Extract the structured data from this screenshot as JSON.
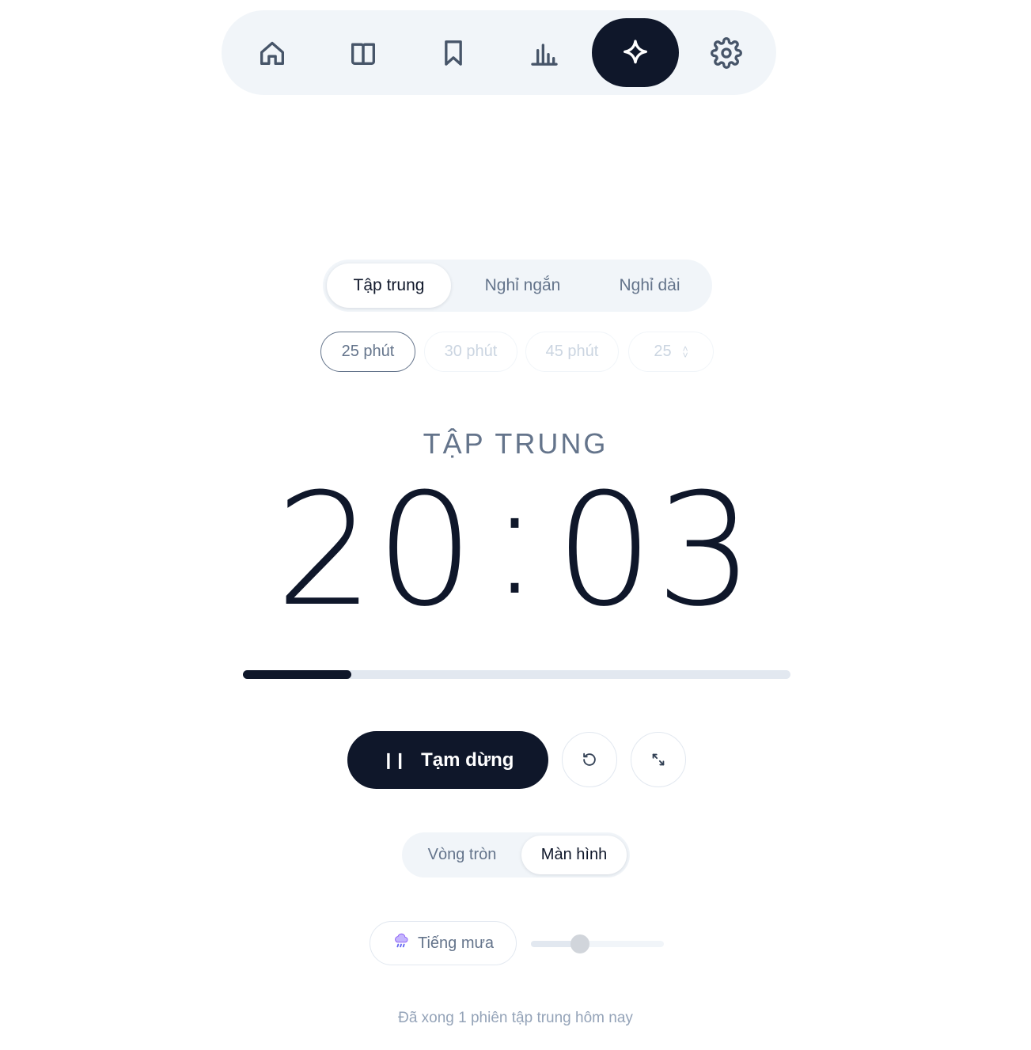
{
  "nav": {
    "items": [
      {
        "name": "home",
        "icon": "home-icon",
        "active": false
      },
      {
        "name": "library",
        "icon": "book-open-icon",
        "active": false
      },
      {
        "name": "bookmarks",
        "icon": "bookmark-icon",
        "active": false
      },
      {
        "name": "stats",
        "icon": "bar-chart-icon",
        "active": false
      },
      {
        "name": "focus",
        "icon": "sparkle-icon",
        "active": true
      },
      {
        "name": "settings",
        "icon": "gear-icon",
        "active": false
      }
    ]
  },
  "modes": {
    "tabs": [
      {
        "label": "Tập trung",
        "active": true
      },
      {
        "label": "Nghỉ ngắn",
        "active": false
      },
      {
        "label": "Nghỉ dài",
        "active": false
      }
    ]
  },
  "presets": {
    "options": [
      {
        "label": "25 phút",
        "active": true
      },
      {
        "label": "30 phút",
        "active": false
      },
      {
        "label": "45 phút",
        "active": false
      }
    ],
    "custom_value": "25"
  },
  "timer": {
    "label": "TẬP TRUNG",
    "minutes": "20",
    "separator": ":",
    "seconds": "03",
    "progress_percent": 19.8
  },
  "controls": {
    "pause_label": "Tạm dừng",
    "pause_icon": "pause-icon",
    "reset_icon": "reset-icon",
    "fullscreen_icon": "expand-icon"
  },
  "view": {
    "options": [
      {
        "label": "Vòng tròn",
        "active": false
      },
      {
        "label": "Màn hình",
        "active": true
      }
    ]
  },
  "sound": {
    "label": "Tiếng mưa",
    "icon": "rain-cloud-icon",
    "volume_percent": 37
  },
  "footer": {
    "note": "Đã xong 1 phiên tập trung hôm nay"
  },
  "colors": {
    "accent": "#0f172a",
    "muted": "#64748b",
    "surface": "#f1f5f9"
  }
}
